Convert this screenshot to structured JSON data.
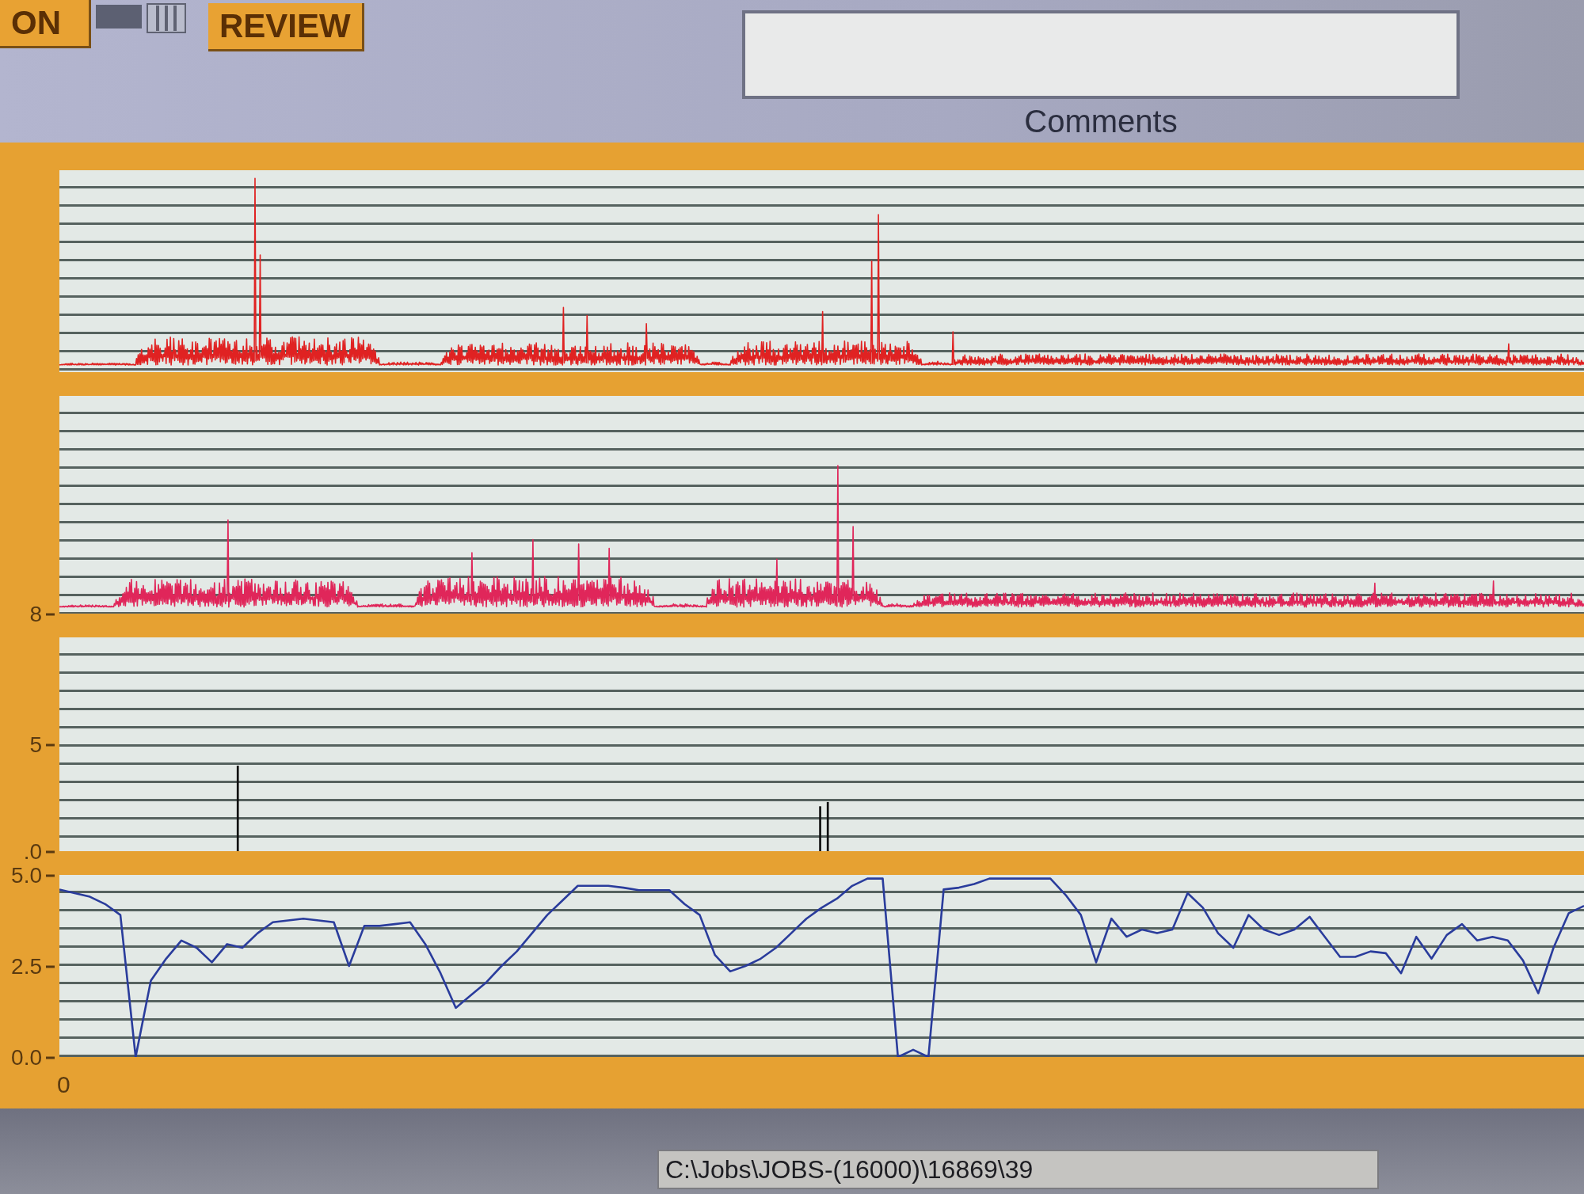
{
  "buttons": [
    {
      "label": "ON"
    },
    {
      "label": "REVIEW"
    }
  ],
  "comments": {
    "label": "Comments"
  },
  "panels": [
    {
      "kind": "trace",
      "color": "#e02222"
    },
    {
      "kind": "trace",
      "color": "#e0265a",
      "axis_labels": [
        "8"
      ]
    },
    {
      "kind": "spikes",
      "color": "#111111",
      "axis_labels": [
        "5",
        ".0"
      ]
    },
    {
      "kind": "line",
      "chart_data": {
        "type": "line",
        "ylim": [
          0,
          5
        ],
        "yticks": [
          {
            "value": 5,
            "label": "5.0"
          },
          {
            "value": 2.5,
            "label": "2.5"
          },
          {
            "value": 0,
            "label": "0.0"
          }
        ],
        "series": [
          {
            "color": "#2a3c9c",
            "values": [
              4.6,
              4.5,
              4.4,
              4.2,
              3.9,
              0.0,
              2.1,
              2.7,
              3.2,
              3.0,
              2.6,
              3.1,
              3.0,
              3.4,
              3.7,
              3.75,
              3.8,
              3.75,
              3.7,
              2.5,
              3.6,
              3.6,
              3.65,
              3.7,
              3.1,
              2.3,
              1.35,
              1.7,
              2.05,
              2.5,
              2.9,
              3.4,
              3.9,
              4.3,
              4.7,
              4.7,
              4.7,
              4.65,
              4.58,
              4.58,
              4.58,
              4.2,
              3.9,
              2.8,
              2.35,
              2.5,
              2.7,
              3.0,
              3.4,
              3.8,
              4.1,
              4.35,
              4.7,
              4.9,
              4.9,
              0.0,
              0.2,
              0.0,
              4.6,
              4.65,
              4.75,
              4.9,
              4.9,
              4.9,
              4.9,
              4.9,
              4.45,
              3.9,
              2.6,
              3.8,
              3.3,
              3.5,
              3.4,
              3.5,
              4.5,
              4.1,
              3.4,
              3.0,
              3.9,
              3.5,
              3.35,
              3.5,
              3.85,
              3.3,
              2.75,
              2.75,
              2.9,
              2.85,
              2.3,
              3.3,
              2.7,
              3.35,
              3.65,
              3.2,
              3.3,
              3.2,
              2.65,
              1.75,
              3.0,
              3.95,
              4.15
            ]
          }
        ]
      }
    }
  ],
  "x_axis": {
    "labels": [
      "0"
    ]
  },
  "status_bar": {
    "path": "C:\\Jobs\\JOBS-(16000)\\16869\\39"
  }
}
